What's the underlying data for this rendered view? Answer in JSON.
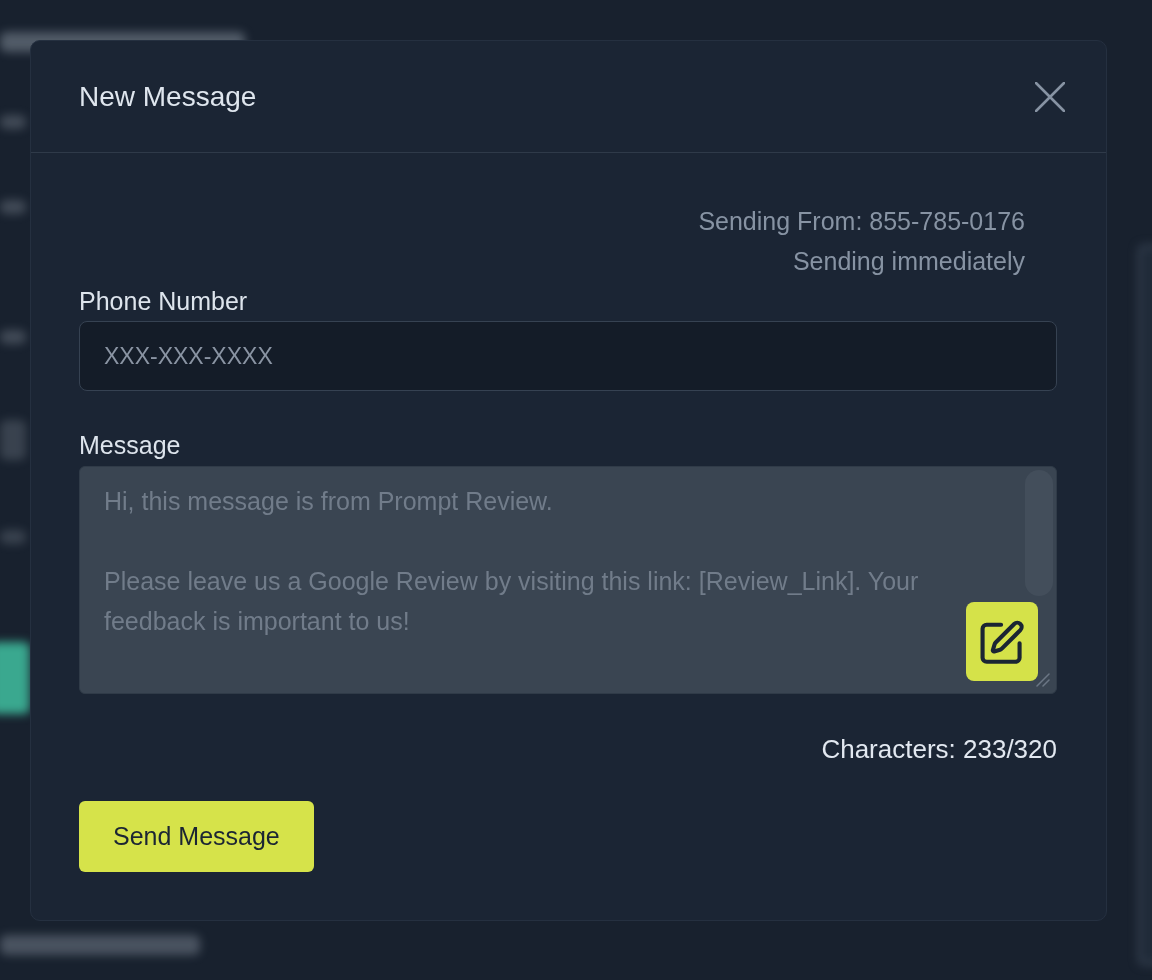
{
  "dialog": {
    "title": "New Message"
  },
  "sender": {
    "from": "Sending From: 855-785-0176",
    "timing": "Sending immediately"
  },
  "phone_field": {
    "label": "Phone Number",
    "placeholder": "XXX-XXX-XXXX"
  },
  "message_field": {
    "label": "Message",
    "value": "Hi, this message is from Prompt Review.\n\nPlease leave us a Google Review by visiting this link: [Review_Link]. Your feedback is important to us!"
  },
  "character_count": "Characters: 233/320",
  "send_button": {
    "label": "Send Message"
  }
}
